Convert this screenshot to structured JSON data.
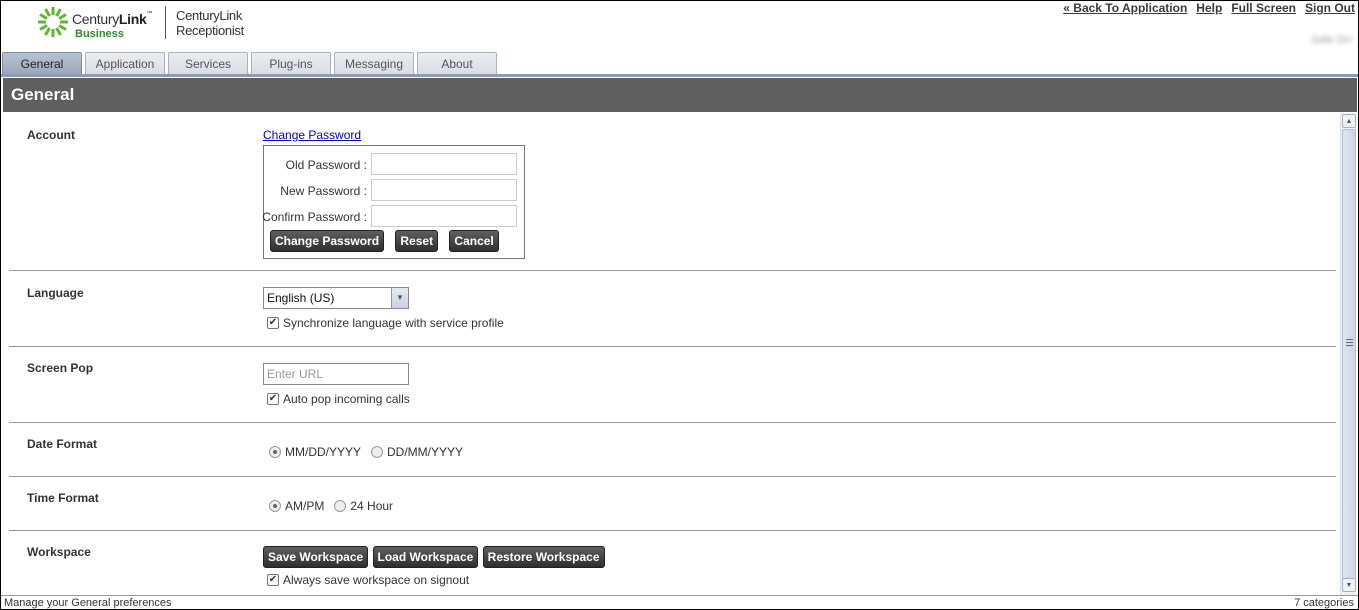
{
  "header": {
    "brand_name_light": "Century",
    "brand_name_bold": "Link",
    "brand_tm": "™",
    "brand_sub": "Business",
    "product_line1": "CenturyLink",
    "product_line2": "Receptionist",
    "links": [
      "« Back To Application",
      "Help",
      "Full Screen",
      "Sign Out"
    ],
    "user_name": "Julie Orr",
    "logo_color": "#5cb82e"
  },
  "tabs": [
    {
      "label": "General",
      "active": true
    },
    {
      "label": "Application",
      "active": false
    },
    {
      "label": "Services",
      "active": false
    },
    {
      "label": "Plug-ins",
      "active": false
    },
    {
      "label": "Messaging",
      "active": false
    },
    {
      "label": "About",
      "active": false
    }
  ],
  "section_title": "General",
  "account": {
    "label": "Account",
    "change_password_link": "Change Password",
    "fields": [
      {
        "label": "Old Password :",
        "value": ""
      },
      {
        "label": "New Password :",
        "value": ""
      },
      {
        "label": "Confirm Password :",
        "value": ""
      }
    ],
    "buttons": [
      "Change Password",
      "Reset",
      "Cancel"
    ]
  },
  "language": {
    "label": "Language",
    "selected": "English (US)",
    "sync_label": "Synchronize language with service profile",
    "sync_checked": true
  },
  "screen_pop": {
    "label": "Screen Pop",
    "url_placeholder": "Enter URL",
    "url_value": "",
    "auto_pop_label": "Auto pop incoming calls",
    "auto_pop_checked": true
  },
  "date_format": {
    "label": "Date Format",
    "options": [
      "MM/DD/YYYY",
      "DD/MM/YYYY"
    ],
    "selected": "MM/DD/YYYY"
  },
  "time_format": {
    "label": "Time Format",
    "options": [
      "AM/PM",
      "24 Hour"
    ],
    "selected": "AM/PM"
  },
  "workspace": {
    "label": "Workspace",
    "buttons": [
      "Save Workspace",
      "Load Workspace",
      "Restore Workspace"
    ],
    "always_save_label": "Always save workspace on signout",
    "always_save_checked": true
  },
  "statusbar": {
    "left": "Manage your General preferences",
    "right": "7 categories"
  }
}
